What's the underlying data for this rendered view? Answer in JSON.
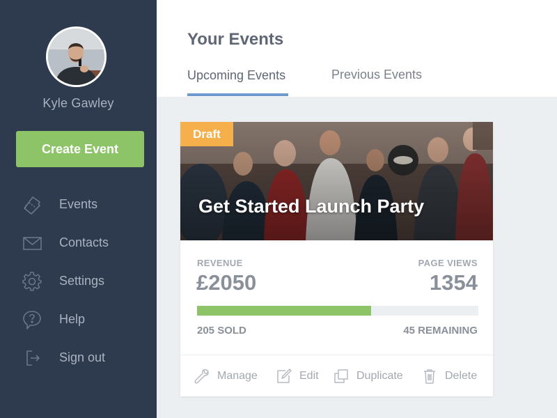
{
  "user": {
    "name": "Kyle Gawley"
  },
  "sidebar": {
    "create_button": "Create Event",
    "items": [
      {
        "label": "Events",
        "icon": "ticket-icon"
      },
      {
        "label": "Contacts",
        "icon": "envelope-icon"
      },
      {
        "label": "Settings",
        "icon": "gear-icon"
      },
      {
        "label": "Help",
        "icon": "help-bubble-icon"
      },
      {
        "label": "Sign out",
        "icon": "sign-out-icon"
      }
    ]
  },
  "header": {
    "title": "Your Events",
    "tabs": [
      {
        "label": "Upcoming Events",
        "active": true
      },
      {
        "label": "Previous Events",
        "active": false
      }
    ]
  },
  "event_card": {
    "status_badge": "Draft",
    "title": "Get Started Launch Party",
    "revenue_label": "REVENUE",
    "revenue_value": "£2050",
    "views_label": "PAGE VIEWS",
    "views_value": "1354",
    "sold_label": "205 SOLD",
    "remaining_label": "45 REMAINING",
    "sold_fraction": 0.62,
    "actions": [
      {
        "label": "Manage",
        "icon": "wrench-icon"
      },
      {
        "label": "Edit",
        "icon": "pencil-icon"
      },
      {
        "label": "Duplicate",
        "icon": "duplicate-icon"
      },
      {
        "label": "Delete",
        "icon": "trash-icon"
      }
    ]
  },
  "colors": {
    "sidebar_bg": "#2e3a4d",
    "accent_green": "#8cc467",
    "draft_orange": "#f5b04b",
    "tab_underline_blue": "#6f9ad0",
    "page_bg": "#eceff2"
  }
}
